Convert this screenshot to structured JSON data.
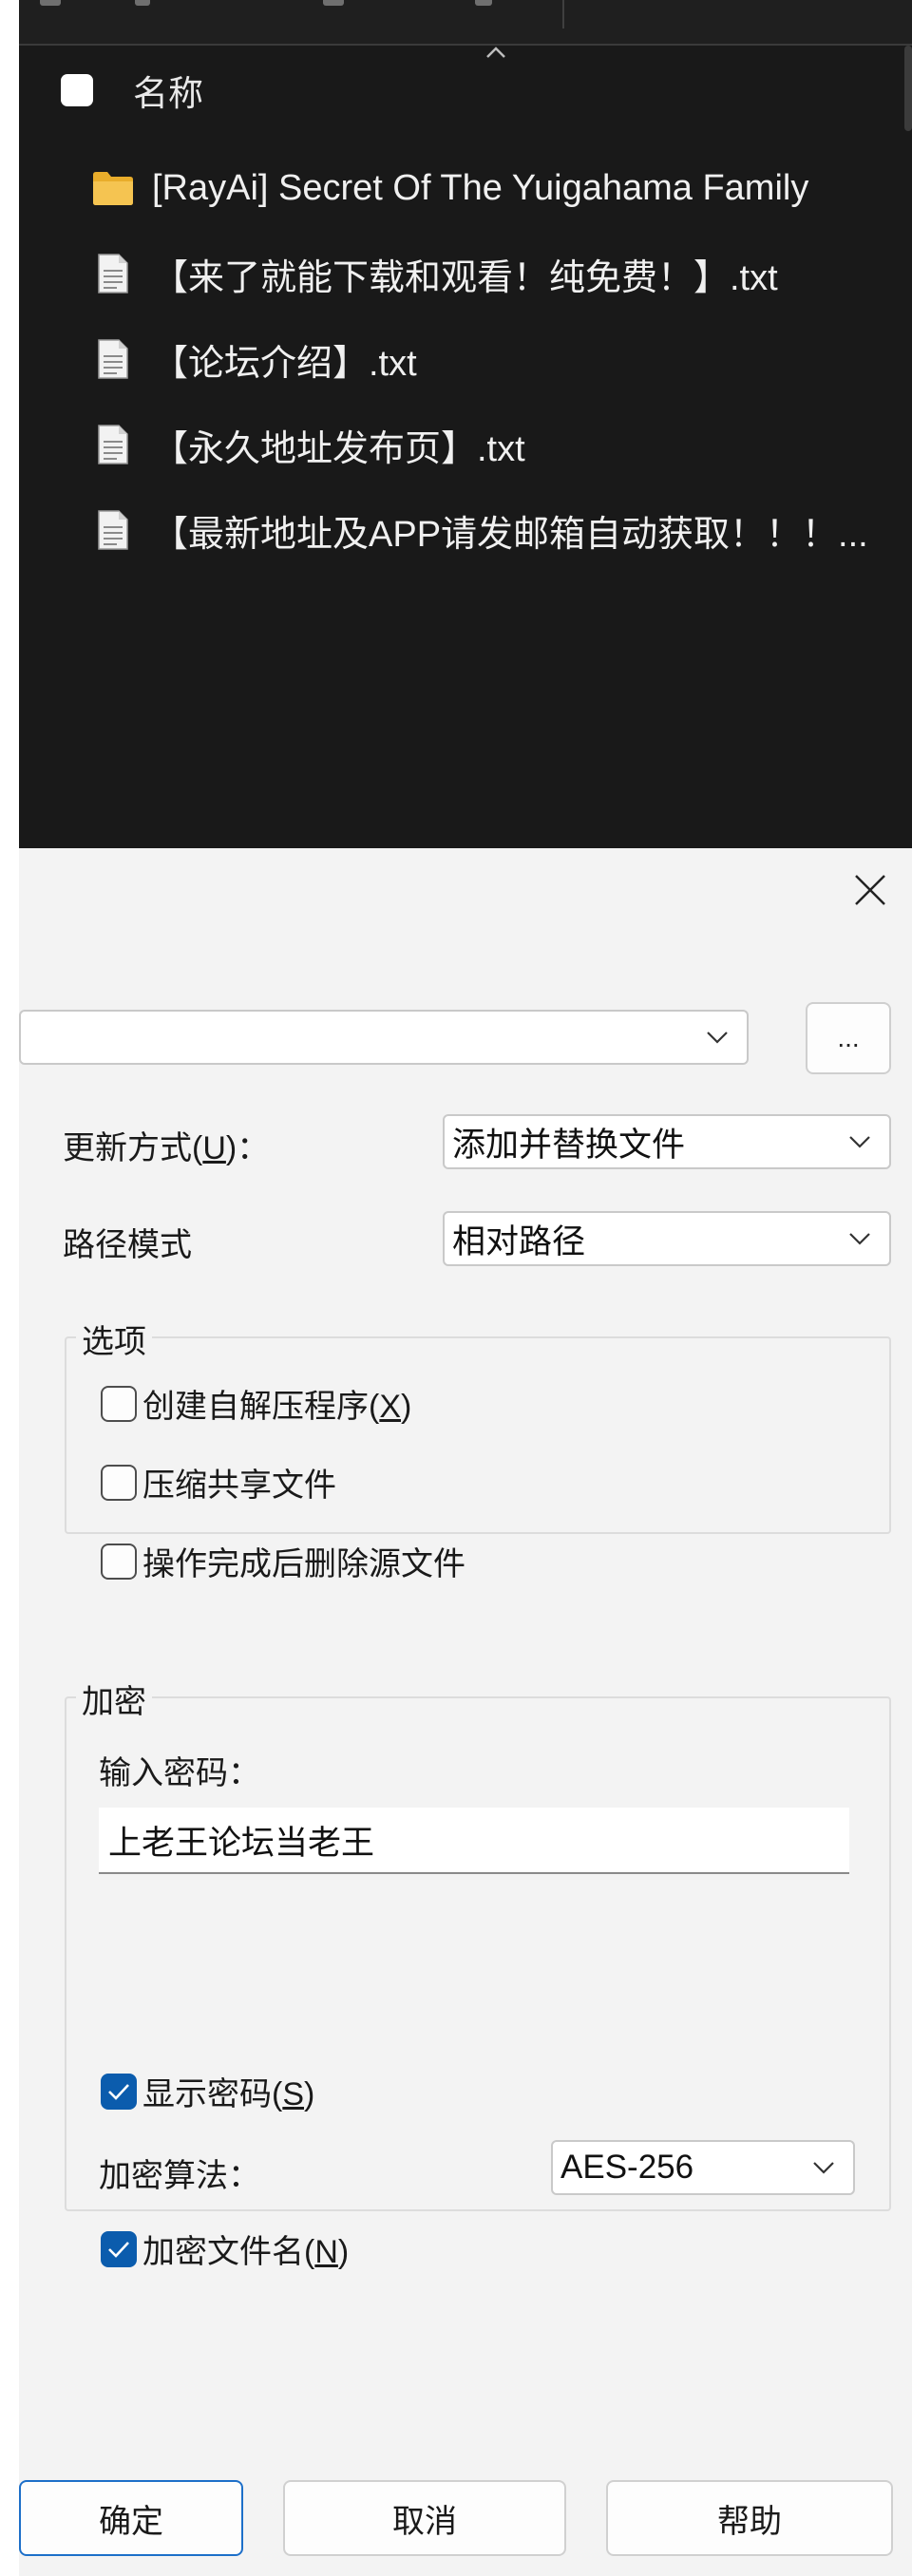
{
  "explorer": {
    "header": {
      "column_name": "名称"
    },
    "files": [
      {
        "type": "folder",
        "name": "[RayAi] Secret Of The Yuigahama Family"
      },
      {
        "type": "file",
        "name": "【来了就能下载和观看！纯免费！】.txt"
      },
      {
        "type": "file",
        "name": "【论坛介绍】.txt"
      },
      {
        "type": "file",
        "name": "【永久地址发布页】.txt"
      },
      {
        "type": "file",
        "name": "【最新地址及APP请发邮箱自动获取！！！..."
      }
    ]
  },
  "dialog": {
    "archive_path": {
      "value": "",
      "browse_label": "..."
    },
    "update_mode": {
      "label_pre": "更新方式(",
      "accel": "U",
      "label_post": ")：",
      "value": "添加并替换文件"
    },
    "path_mode": {
      "label": "路径模式",
      "value": "相对路径"
    },
    "options": {
      "title": "选项",
      "items": [
        {
          "label_pre": "创建自解压程序(",
          "accel": "X",
          "label_post": ")",
          "checked": false
        },
        {
          "label": "压缩共享文件",
          "checked": false
        },
        {
          "label": "操作完成后删除源文件",
          "checked": false
        }
      ]
    },
    "encryption": {
      "title": "加密",
      "password_label": "输入密码：",
      "password_value": "上老王论坛当老王",
      "show_password": {
        "label_pre": "显示密码(",
        "accel": "S",
        "label_post": ")",
        "checked": true
      },
      "algorithm_label": "加密算法：",
      "algorithm_value": "AES-256",
      "encrypt_filenames": {
        "label_pre": "加密文件名(",
        "accel": "N",
        "label_post": ")",
        "checked": true
      }
    },
    "buttons": {
      "ok": "确定",
      "cancel": "取消",
      "help": "帮助"
    }
  },
  "colors": {
    "accent": "#0b5cad",
    "explorer_bg": "#191919",
    "dialog_bg": "#f3f3f3",
    "folder": "#f5c451"
  }
}
